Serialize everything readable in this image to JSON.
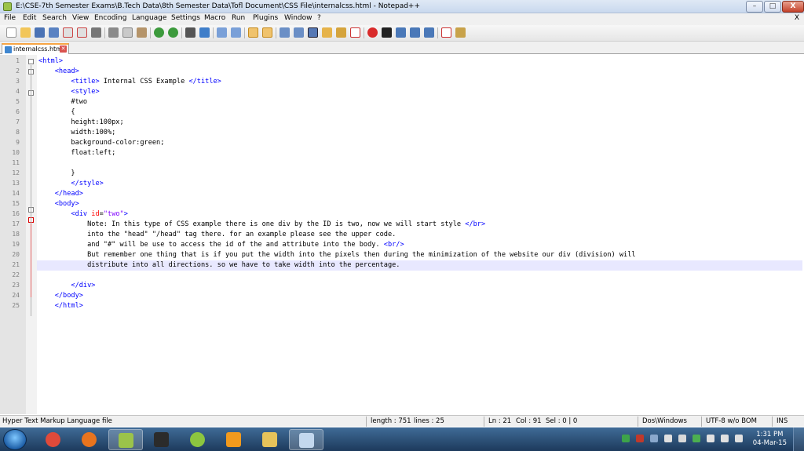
{
  "window": {
    "title": "E:\\CSE-7th Semester Exams\\B.Tech Data\\8th Semester Data\\Tofl Document\\CSS File\\internalcss.html - Notepad++",
    "minimize": "–",
    "maximize": "□",
    "close": "X"
  },
  "menu": {
    "items": [
      "File",
      "Edit",
      "Search",
      "View",
      "Encoding",
      "Language",
      "Settings",
      "Macro",
      "Run",
      "Plugins",
      "Window",
      "?"
    ],
    "close_doc": "X"
  },
  "tab": {
    "name": "internalcss.html",
    "close": "✕"
  },
  "editor": {
    "current_line": 21,
    "lines": [
      {
        "n": "1",
        "text": "<html>"
      },
      {
        "n": "2",
        "text": "    <head>"
      },
      {
        "n": "3",
        "text": "        <title> Internal CSS Example </title>"
      },
      {
        "n": "4",
        "text": "        <style>"
      },
      {
        "n": "5",
        "text": "        #two"
      },
      {
        "n": "6",
        "text": "        {"
      },
      {
        "n": "7",
        "text": "        height:100px;"
      },
      {
        "n": "8",
        "text": "        width:100%;"
      },
      {
        "n": "9",
        "text": "        background-color:green;"
      },
      {
        "n": "10",
        "text": "        float:left;"
      },
      {
        "n": "11",
        "text": ""
      },
      {
        "n": "12",
        "text": "        }"
      },
      {
        "n": "13",
        "text": "        </style>"
      },
      {
        "n": "14",
        "text": "    </head>"
      },
      {
        "n": "15",
        "text": "    <body>"
      },
      {
        "n": "16",
        "text": "        <div id=\"two\">"
      },
      {
        "n": "17",
        "text": "            Note: In this type of CSS example there is one div by the ID is two, now we will start style </br>"
      },
      {
        "n": "18",
        "text": "            into the \"head\" \"/head\" tag there. for an example please see the upper code."
      },
      {
        "n": "19",
        "text": "            and \"#\" will be use to access the id of the and attribute into the body. <br/>"
      },
      {
        "n": "20",
        "text": "            But remember one thing that is if you put the width into the pixels then during the minimization of the website our div (division) will"
      },
      {
        "n": "21",
        "text": "            distribute into all directions. so we have to take width into the percentage."
      },
      {
        "n": "22",
        "text": ""
      },
      {
        "n": "23",
        "text": "        </div>"
      },
      {
        "n": "24",
        "text": "    </body>"
      },
      {
        "n": "25",
        "text": "    </html>"
      }
    ]
  },
  "status": {
    "language": "Hyper Text Markup Language file",
    "length": "length : 751",
    "lines": "lines : 25",
    "ln": "Ln : 21",
    "col": "Col : 91",
    "sel": "Sel : 0 | 0",
    "eol": "Dos\\Windows",
    "encoding": "UTF-8 w/o BOM",
    "mode": "INS"
  },
  "taskbar": {
    "time": "1:31 PM",
    "date": "04-Mar-15",
    "apps": [
      {
        "icon": "chrome-icon",
        "color": "#e04a3a"
      },
      {
        "icon": "firefox-icon",
        "color": "#e8741e"
      },
      {
        "icon": "notepadpp-icon",
        "color": "#9bc34a",
        "active": true
      },
      {
        "icon": "color-picker-icon",
        "color": "#2b2b2b"
      },
      {
        "icon": "chameleon-icon",
        "color": "#8cc63f"
      },
      {
        "icon": "media-player-icon",
        "color": "#f29a1d"
      },
      {
        "icon": "file-explorer-icon",
        "color": "#e7c35a"
      },
      {
        "icon": "paint-icon",
        "color": "#c4d8ee",
        "active": true
      }
    ]
  },
  "colors": {
    "tag": "#0000ff",
    "attr": "#ff0000",
    "string": "#8000ff",
    "current_line": "#e8e8ff"
  }
}
